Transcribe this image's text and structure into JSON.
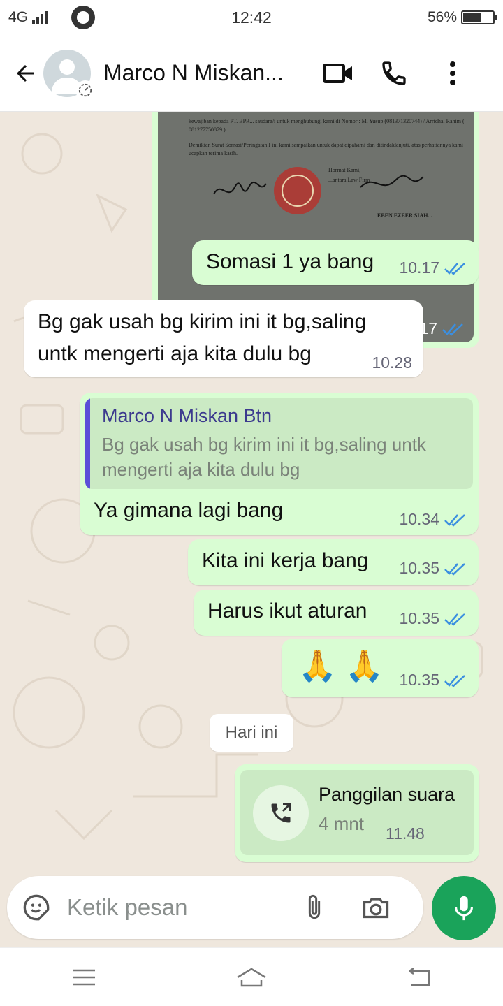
{
  "status": {
    "network": "4G",
    "time": "12:42",
    "battery": "56%",
    "battery_level": 0.56
  },
  "header": {
    "contact_name": "Marco N Miskan..."
  },
  "messages": {
    "image": {
      "time": "10.17",
      "doc_lines": [
        "kewajiban kepada PT. BPR... saudara/i untuk menghubungi kami di Nomor : M. Yusup (081371320744) / Arridhal Rahim ( 081277750879 ).",
        "Demikian Surat Somasi/Peringatan I ini kami sampaikan untuk dapat dipahami dan ditindaklanjuti, atas perhatiannya kami ucapkan terima kasih.",
        "Hormat Kami,",
        "...antara Law Firm",
        "EBEN EZEER SIAH..."
      ]
    },
    "m1": {
      "text": "Somasi 1 ya bang",
      "time": "10.17"
    },
    "m2": {
      "text_l1": "Bg gak usah bg kirim ini it bg,saling",
      "text_l2": "untk mengerti aja kita dulu bg",
      "time": "10.28"
    },
    "m3": {
      "quote_name": "Marco N Miskan Btn",
      "quote_l1": "Bg gak usah bg kirim ini it bg,saling untk",
      "quote_l2": "mengerti aja kita dulu bg",
      "text": "Ya gimana lagi bang",
      "time": "10.34"
    },
    "m4": {
      "text": "Kita ini kerja bang",
      "time": "10.35"
    },
    "m5": {
      "text": "Harus ikut aturan",
      "time": "10.35"
    },
    "m6": {
      "text": "🙏 🙏",
      "time": "10.35"
    },
    "date_chip": "Hari ini",
    "call": {
      "title": "Panggilan suara",
      "duration": "4 mnt",
      "time": "11.48"
    }
  },
  "input": {
    "placeholder": "Ketik pesan"
  },
  "colors": {
    "outgoing": "#d9fdd3",
    "incoming": "#ffffff",
    "accent": "#1aa35a",
    "read_ticks": "#3b8fe0",
    "wallpaper": "#efe7dd"
  },
  "icons": [
    "back-arrow-icon",
    "avatar-icon",
    "video-call-icon",
    "phone-icon",
    "more-vert-icon",
    "double-check-icon",
    "call-outgoing-icon",
    "sticker-icon",
    "attach-icon",
    "camera-icon",
    "mic-icon",
    "menu-icon",
    "home-icon",
    "back-icon"
  ]
}
